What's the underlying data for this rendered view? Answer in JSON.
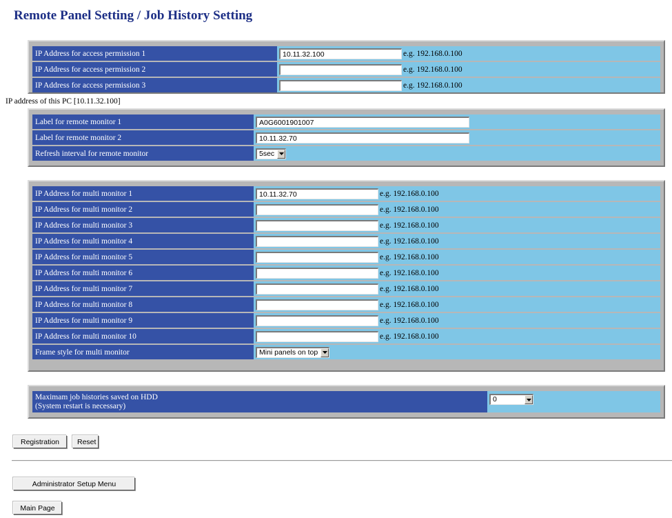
{
  "page": {
    "title": "Remote Panel Setting / Job History Setting"
  },
  "access": {
    "rows": [
      {
        "label": "IP Address for access permission 1",
        "value": "10.11.32.100",
        "example": "e.g. 192.168.0.100"
      },
      {
        "label": "IP Address for access permission 2",
        "value": "",
        "example": "e.g. 192.168.0.100"
      },
      {
        "label": "IP Address for access permission 3",
        "value": "",
        "example": "e.g. 192.168.0.100"
      }
    ]
  },
  "pc_ip_note": "IP address of this PC [10.11.32.100]",
  "remote": {
    "label1": "Label for remote monitor 1",
    "value1": "A0G6001901007",
    "label2": "Label for remote monitor 2",
    "value2": "10.11.32.70",
    "refresh_label": "Refresh interval for remote monitor",
    "refresh_value": "5sec"
  },
  "multi": {
    "rows": [
      {
        "label": "IP Address for multi monitor 1",
        "value": "10.11.32.70",
        "example": "e.g. 192.168.0.100"
      },
      {
        "label": "IP Address for multi monitor 2",
        "value": "",
        "example": "e.g. 192.168.0.100"
      },
      {
        "label": "IP Address for multi monitor 3",
        "value": "",
        "example": "e.g. 192.168.0.100"
      },
      {
        "label": "IP Address for multi monitor 4",
        "value": "",
        "example": "e.g. 192.168.0.100"
      },
      {
        "label": "IP Address for multi monitor 5",
        "value": "",
        "example": "e.g. 192.168.0.100"
      },
      {
        "label": "IP Address for multi monitor 6",
        "value": "",
        "example": "e.g. 192.168.0.100"
      },
      {
        "label": "IP Address for multi monitor 7",
        "value": "",
        "example": "e.g. 192.168.0.100"
      },
      {
        "label": "IP Address for multi monitor 8",
        "value": "",
        "example": "e.g. 192.168.0.100"
      },
      {
        "label": "IP Address for multi monitor 9",
        "value": "",
        "example": "e.g. 192.168.0.100"
      },
      {
        "label": "IP Address for multi monitor 10",
        "value": "",
        "example": "e.g. 192.168.0.100"
      }
    ],
    "frame_label": "Frame style for multi monitor",
    "frame_value": "Mini panels on top"
  },
  "history": {
    "label_line1": "Maximam job histories saved on HDD",
    "label_line2": "(System restart is necessary)",
    "value": "0"
  },
  "buttons": {
    "registration": "Registration",
    "reset": "Reset",
    "admin_menu": "Administrator Setup Menu",
    "main_page": "Main Page"
  },
  "colors": {
    "label_bg": "#3552a6",
    "value_bg": "#7fc6e6",
    "panel_bg": "#b7b7b7",
    "title": "#1d2f86"
  }
}
